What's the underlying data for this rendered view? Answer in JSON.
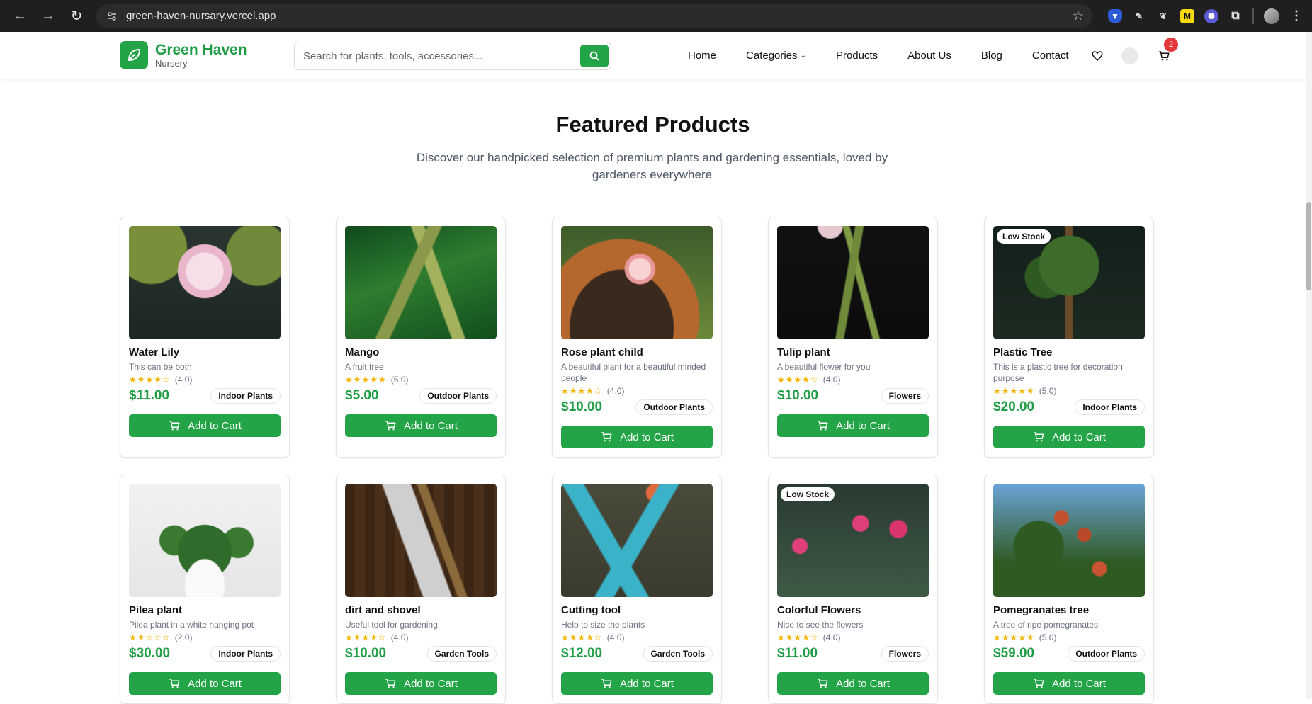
{
  "browser": {
    "url": "green-haven-nursary.vercel.app"
  },
  "brand": {
    "name": "Green Haven",
    "sub": "Nursery",
    "accent": "#22a447"
  },
  "search": {
    "placeholder": "Search for plants, tools, accessories..."
  },
  "nav": {
    "home": "Home",
    "categories": "Categories",
    "products": "Products",
    "about": "About Us",
    "blog": "Blog",
    "contact": "Contact"
  },
  "cart": {
    "count": "2"
  },
  "section": {
    "title": "Featured Products",
    "subtitle": "Discover our handpicked selection of premium plants and gardening essentials, loved by gardeners everywhere"
  },
  "products": [
    {
      "name": "Water Lily",
      "desc": "This can be both",
      "stars": "★★★★☆",
      "rating": "(4.0)",
      "price": "$11.00",
      "category": "Indoor Plants",
      "low_stock": "",
      "button": "Add to Cart"
    },
    {
      "name": "Mango",
      "desc": "A fruit tree",
      "stars": "★★★★★",
      "rating": "(5.0)",
      "price": "$5.00",
      "category": "Outdoor Plants",
      "low_stock": "",
      "button": "Add to Cart"
    },
    {
      "name": "Rose plant child",
      "desc": "A beautiful plant for a beautiful minded people",
      "stars": "★★★★☆",
      "rating": "(4.0)",
      "price": "$10.00",
      "category": "Outdoor Plants",
      "low_stock": "",
      "button": "Add to Cart"
    },
    {
      "name": "Tulip plant",
      "desc": "A beautiful flower for you",
      "stars": "★★★★☆",
      "rating": "(4.0)",
      "price": "$10.00",
      "category": "Flowers",
      "low_stock": "",
      "button": "Add to Cart"
    },
    {
      "name": "Plastic Tree",
      "desc": "This is a plastic tree for decoration purpose",
      "stars": "★★★★★",
      "rating": "(5.0)",
      "price": "$20.00",
      "category": "Indoor Plants",
      "low_stock": "Low Stock",
      "button": "Add to Cart"
    },
    {
      "name": "Pilea plant",
      "desc": "Pilea plant in a white hanging pot",
      "stars": "★★☆☆☆",
      "rating": "(2.0)",
      "price": "$30.00",
      "category": "Indoor Plants",
      "low_stock": "",
      "button": "Add to Cart"
    },
    {
      "name": "dirt and shovel",
      "desc": "Useful tool for gardening",
      "stars": "★★★★☆",
      "rating": "(4.0)",
      "price": "$10.00",
      "category": "Garden Tools",
      "low_stock": "",
      "button": "Add to Cart"
    },
    {
      "name": "Cutting tool",
      "desc": "Help to size the plants",
      "stars": "★★★★☆",
      "rating": "(4.0)",
      "price": "$12.00",
      "category": "Garden Tools",
      "low_stock": "",
      "button": "Add to Cart"
    },
    {
      "name": "Colorful Flowers",
      "desc": "Nice to see the flowers",
      "stars": "★★★★☆",
      "rating": "(4.0)",
      "price": "$11.00",
      "category": "Flowers",
      "low_stock": "Low Stock",
      "button": "Add to Cart"
    },
    {
      "name": "Pomegranates tree",
      "desc": "A tree of ripe pomegranates",
      "stars": "★★★★★",
      "rating": "(5.0)",
      "price": "$59.00",
      "category": "Outdoor Plants",
      "low_stock": "",
      "button": "Add to Cart"
    }
  ]
}
